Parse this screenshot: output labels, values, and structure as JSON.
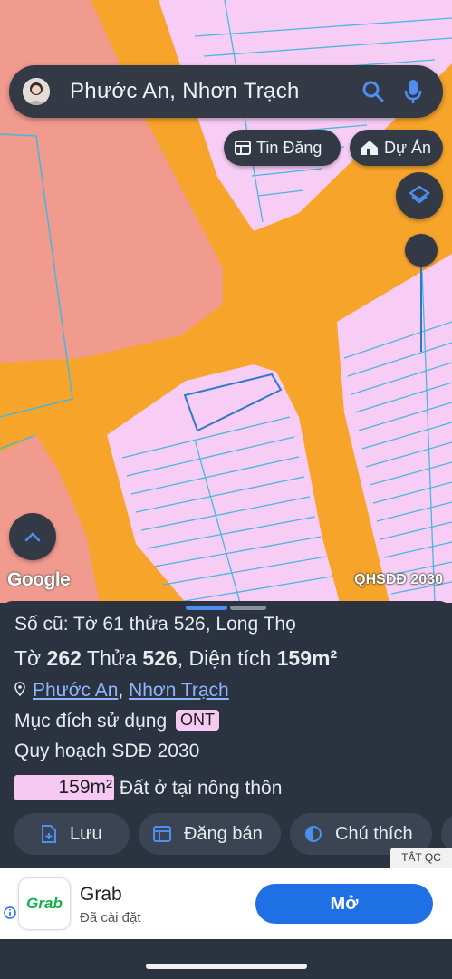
{
  "search": {
    "text": "Phước An, Nhơn Trạch"
  },
  "chips": {
    "listings": "Tin Đăng",
    "projects": "Dự Án"
  },
  "map": {
    "attribution": "Google",
    "overlay_label": "QHSDĐ 2030"
  },
  "colors": {
    "road": "#f7a42a",
    "residential": "#f7cdf6",
    "agri": "#f19a8e",
    "parcel_line": "#48b7dd",
    "accent": "#1f6fe5"
  },
  "sheet": {
    "old_ref": "Số cũ: Tờ 61 thửa 526, Long Thọ",
    "sheet_prefix": "Tờ",
    "sheet_no": "262",
    "parcel_prefix": "Thửa",
    "parcel_no": "526",
    "area_prefix": ", Diện tích",
    "area_value": "159m²",
    "location_ward": "Phước An",
    "location_sep": ",",
    "location_district": "Nhơn Trạch",
    "purpose_label": "Mục đích sử dụng",
    "purpose_code": "ONT",
    "plan_label": "Quy hoạch SDĐ 2030",
    "plan_area": "159m²",
    "plan_desc": "Đất ở tại nông thôn",
    "actions": {
      "save": "Lưu",
      "sell": "Đăng bán",
      "legend": "Chú thích"
    }
  },
  "ad": {
    "close_label": "TẮT QC",
    "logo_text": "Grab",
    "title": "Grab",
    "subtitle": "Đã cài đặt",
    "cta": "Mở"
  }
}
